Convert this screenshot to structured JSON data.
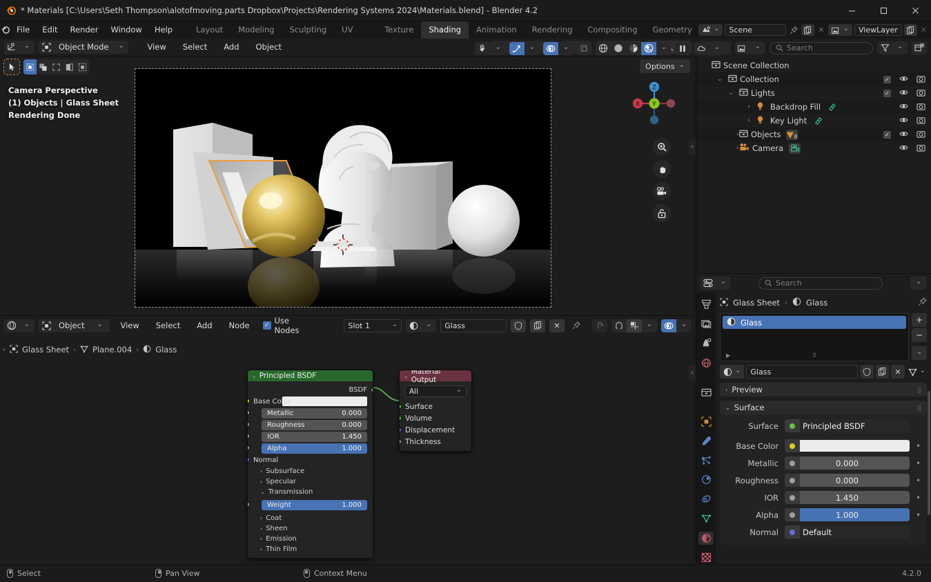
{
  "window": {
    "title": "* Materials [C:\\Users\\Seth Thompson\\alotofmoving.parts Dropbox\\Projects\\Rendering Systems 2024\\Materials.blend] - Blender 4.2",
    "minimize": "—",
    "maximize": "□",
    "close": "✕"
  },
  "topbar": {
    "menus": [
      "File",
      "Edit",
      "Render",
      "Window",
      "Help"
    ],
    "workspaces": [
      "Layout",
      "Modeling",
      "Sculpting",
      "UV Editing",
      "Texture Paint",
      "Shading",
      "Animation",
      "Rendering",
      "Compositing",
      "Geometry N"
    ],
    "active_workspace": "Shading",
    "scene_name": "Scene",
    "viewlayer_name": "ViewLayer"
  },
  "viewport_header": {
    "editor_type": "editor-type-3dview",
    "mode": "Object Mode",
    "menus": [
      "View",
      "Select",
      "Add",
      "Object"
    ],
    "transform_orientation": "Global",
    "pivot": "pivot-point-icon",
    "snap": "magnet-icon",
    "proportional": "proportional-edit-icon",
    "shading_modes": [
      "wireframe",
      "solid",
      "material-preview",
      "rendered"
    ],
    "active_shading_mode": "rendered"
  },
  "viewport": {
    "options_label": "Options",
    "overlay_text_line1": "Camera Perspective",
    "overlay_text_line2": "(1) Objects | Glass Sheet",
    "overlay_text_line3": "Rendering Done",
    "gizmo_axes": {
      "x": "X",
      "y": "Y",
      "z": "Z"
    },
    "gizmo_colors": {
      "x": "#d0485a",
      "y": "#8bc520",
      "z": "#3f8fd0"
    },
    "nav_buttons": [
      "zoom-icon",
      "pan-icon",
      "camera-view-icon",
      "toggle-ortho-icon"
    ],
    "selected_object_outline_color": "#ed9e3f"
  },
  "outliner": {
    "display_mode": "view-layer",
    "search_placeholder": "Search",
    "rows": [
      {
        "label": "Scene Collection",
        "indent": 0,
        "icon": "collection-icon",
        "expand": "",
        "checkbox": false,
        "hide": false,
        "render": false
      },
      {
        "label": "Collection",
        "indent": 1,
        "icon": "collection-icon",
        "expand": "v",
        "checkbox": true,
        "hide": true,
        "render": true
      },
      {
        "label": "Lights",
        "indent": 2,
        "icon": "collection-icon",
        "expand": "v",
        "checkbox": true,
        "hide": true,
        "render": true
      },
      {
        "label": "Backdrop Fill",
        "indent": 3,
        "icon": "light-icon",
        "expand": ">",
        "checkbox": false,
        "hide": true,
        "render": true,
        "badge": "light-data-icon"
      },
      {
        "label": "Key Light",
        "indent": 3,
        "icon": "light-icon",
        "expand": ">",
        "checkbox": false,
        "hide": true,
        "render": true,
        "badge": "light-data-icon"
      },
      {
        "label": "Objects",
        "indent": 2,
        "icon": "collection-icon",
        "expand": ">",
        "checkbox": true,
        "hide": true,
        "render": true,
        "badge": "mesh-data-icon",
        "badge_count": "8"
      },
      {
        "label": "Camera",
        "indent": 2,
        "icon": "camera-icon",
        "expand": ">",
        "checkbox": false,
        "hide": true,
        "render": true,
        "badge": "camera-data-icon"
      }
    ]
  },
  "shader_editor": {
    "editor_type": "shader-editor",
    "shader_type": "Object",
    "menus": [
      "View",
      "Select",
      "Add",
      "Node"
    ],
    "use_nodes_label": "Use Nodes",
    "use_nodes_checked": true,
    "slot": "Slot 1",
    "material_name": "Glass",
    "breadcrumb": [
      "Glass Sheet",
      "Plane.004",
      "Glass"
    ],
    "snap_enabled": false,
    "overlay_enabled": true,
    "nodes": [
      {
        "name": "Principled BSDF",
        "header_color": "#28682c",
        "output_socket": "BSDF",
        "base_color_swatch": "#ececec",
        "inputs": [
          {
            "label": "Base Color",
            "type": "color",
            "value": "",
            "socket": "#dbd02a"
          },
          {
            "label": "Metallic",
            "type": "number",
            "value": "0.000",
            "socket": "#a0a0a0"
          },
          {
            "label": "Roughness",
            "type": "number",
            "value": "0.000",
            "socket": "#a0a0a0"
          },
          {
            "label": "IOR",
            "type": "number",
            "value": "1.450",
            "socket": "#a0a0a0"
          },
          {
            "label": "Alpha",
            "type": "number",
            "value": "1.000",
            "socket": "#a0a0a0",
            "highlight": true
          },
          {
            "label": "Normal",
            "type": "plain",
            "value": "",
            "socket": "#6b6bd6"
          }
        ],
        "sections": [
          {
            "label": "Subsurface",
            "open": false
          },
          {
            "label": "Specular",
            "open": false
          },
          {
            "label": "Transmission",
            "open": true,
            "fields": [
              {
                "label": "Weight",
                "value": "1.000",
                "highlight": true
              }
            ]
          },
          {
            "label": "Coat",
            "open": false
          },
          {
            "label": "Sheen",
            "open": false
          },
          {
            "label": "Emission",
            "open": false
          },
          {
            "label": "Thin Film",
            "open": false
          }
        ]
      },
      {
        "name": "Material Output",
        "header_color": "#6a3140",
        "target": "All",
        "inputs": [
          {
            "label": "Surface",
            "socket": "#6cc04a"
          },
          {
            "label": "Volume",
            "socket": "#6cc04a"
          },
          {
            "label": "Displacement",
            "socket": "#6b6bd6"
          },
          {
            "label": "Thickness",
            "socket": "#a0a0a0"
          }
        ]
      }
    ]
  },
  "properties": {
    "search_placeholder": "Search",
    "breadcrumb": [
      "Glass Sheet",
      "Glass"
    ],
    "material_slots": [
      {
        "name": "Glass",
        "selected": true
      }
    ],
    "material_datablock_name": "Glass",
    "panels": [
      {
        "label": "Preview",
        "open": false
      },
      {
        "label": "Surface",
        "open": true
      }
    ],
    "surface": [
      {
        "label": "Surface",
        "value": "Principled BSDF",
        "type": "shader",
        "socket": "#6cc04a"
      },
      {
        "label": "Base Color",
        "value": "",
        "type": "color",
        "swatch": "#ececec",
        "socket": "#dbd02a"
      },
      {
        "label": "Metallic",
        "value": "0.000",
        "type": "number",
        "socket": "#a0a0a0"
      },
      {
        "label": "Roughness",
        "value": "0.000",
        "type": "number",
        "socket": "#a0a0a0"
      },
      {
        "label": "IOR",
        "value": "1.450",
        "type": "number",
        "socket": "#a0a0a0"
      },
      {
        "label": "Alpha",
        "value": "1.000",
        "type": "number",
        "socket": "#a0a0a0",
        "highlight": true
      },
      {
        "label": "Normal",
        "value": "Default",
        "type": "shader",
        "socket": "#6b6bd6"
      }
    ],
    "tabs": [
      "tool-icon",
      "render-icon",
      "output-icon",
      "viewlayer-icon",
      "scene-icon",
      "world-icon",
      "collection-icon",
      "object-icon",
      "modifier-icon",
      "particles-icon",
      "physics-icon",
      "constraint-icon",
      "data-icon",
      "material-icon",
      "texture-icon"
    ],
    "active_tab": "material-icon"
  },
  "statusbar": {
    "items": [
      {
        "icon": "mouse-left-icon",
        "label": "Select"
      },
      {
        "icon": "mouse-middle-icon",
        "label": "Pan View"
      },
      {
        "icon": "mouse-right-icon",
        "label": "Context Menu"
      }
    ],
    "version": "4.2.0"
  }
}
